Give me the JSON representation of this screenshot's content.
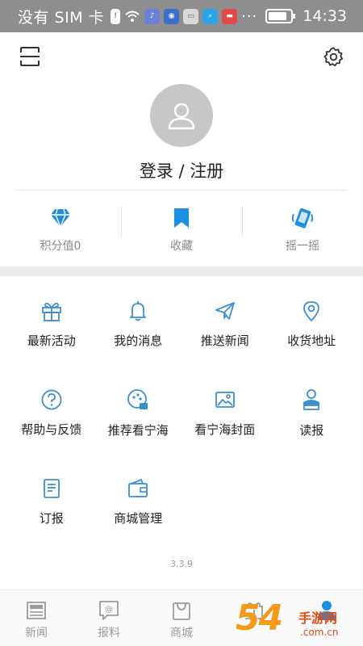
{
  "status_bar": {
    "carrier": "没有 SIM 卡",
    "dots": "···",
    "time": "14:33",
    "battery_level": 0.85
  },
  "profile": {
    "login_label": "登录 / 注册"
  },
  "stats": [
    {
      "label": "积分值0",
      "icon": "diamond-icon"
    },
    {
      "label": "收藏",
      "icon": "bookmark-icon"
    },
    {
      "label": "摇一摇",
      "icon": "shake-phone-icon"
    }
  ],
  "menu": [
    {
      "label": "最新活动",
      "icon": "gift-icon"
    },
    {
      "label": "我的消息",
      "icon": "bell-icon"
    },
    {
      "label": "推送新闻",
      "icon": "paper-plane-icon"
    },
    {
      "label": "收货地址",
      "icon": "location-pin-icon"
    },
    {
      "label": "帮助与反馈",
      "icon": "help-icon"
    },
    {
      "label": "推荐看宁海",
      "icon": "recommend-icon"
    },
    {
      "label": "看宁海封面",
      "icon": "image-icon"
    },
    {
      "label": "读报",
      "icon": "reader-icon"
    },
    {
      "label": "订报",
      "icon": "newspaper-subscribe-icon"
    },
    {
      "label": "商城管理",
      "icon": "wallet-icon"
    }
  ],
  "version": "3.3.9",
  "bottom_nav": [
    {
      "label": "新闻",
      "icon": "news-icon"
    },
    {
      "label": "报料",
      "icon": "report-icon"
    },
    {
      "label": "商城",
      "icon": "shop-bag-icon"
    },
    {
      "label": "",
      "icon": "gift-box-icon"
    },
    {
      "label": "",
      "icon": "user-icon"
    }
  ],
  "watermark": {
    "number": "54",
    "name": "手游网",
    "url": ".com.cn"
  },
  "colors": {
    "accent": "#1d8fe0",
    "icon_blue": "#3a8fd0",
    "status_bar": "#8e8e8e"
  }
}
